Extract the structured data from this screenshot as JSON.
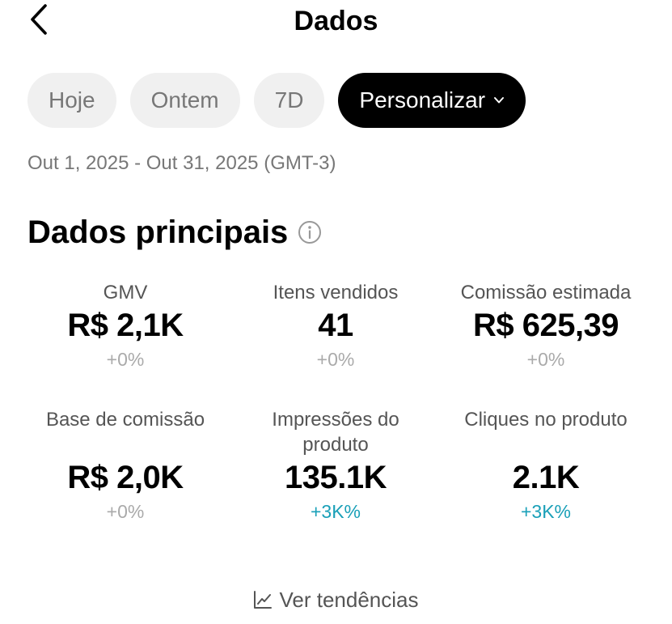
{
  "header": {
    "title": "Dados",
    "back_icon": "chevron-left-icon"
  },
  "filters": {
    "chips": [
      {
        "label": "Hoje",
        "active": false
      },
      {
        "label": "Ontem",
        "active": false
      },
      {
        "label": "7D",
        "active": false
      },
      {
        "label": "Personalizar",
        "active": true,
        "icon": "chevron-down-icon"
      }
    ]
  },
  "date_range": "Out 1, 2025 - Out 31, 2025 (GMT-3)",
  "main_data": {
    "title": "Dados principais",
    "info_icon": "info-icon",
    "metrics": [
      {
        "label": "GMV",
        "value": "R$ 2,1K",
        "change": "+0%"
      },
      {
        "label": "Itens vendidos",
        "value": "41",
        "change": "+0%"
      },
      {
        "label": "Comissão estimada",
        "value": "R$ 625,39",
        "change": "+0%"
      },
      {
        "label": "Base de comissão",
        "value": "R$ 2,0K",
        "change": "+0%"
      },
      {
        "label": "Impressões do produto",
        "value": "135.1K",
        "change": "+3K%"
      },
      {
        "label": "Cliques no produto",
        "value": "2.1K",
        "change": "+3K%"
      }
    ]
  },
  "trends": {
    "label": "Ver tendências",
    "icon": "line-chart-icon"
  },
  "colors": {
    "accent_up": "#1aa0b8",
    "chip_active_bg": "#000000",
    "chip_bg": "#f0f0f0"
  }
}
